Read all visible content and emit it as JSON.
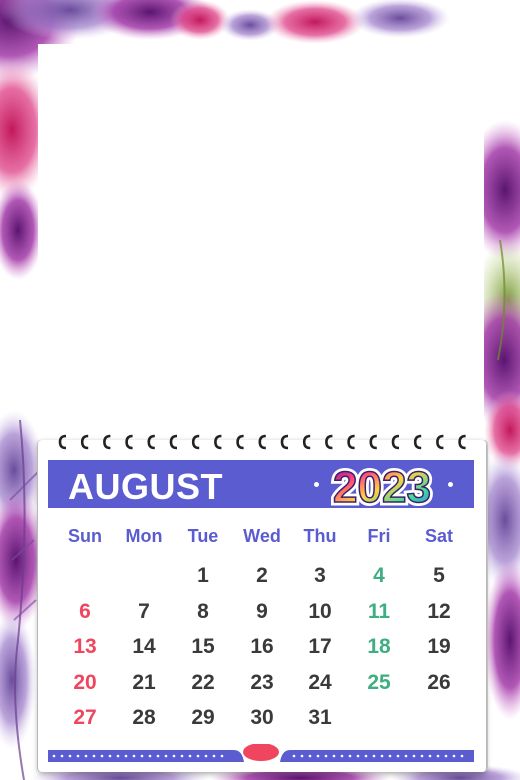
{
  "calendar": {
    "month": "AUGUST",
    "year": "2023",
    "weekdays": [
      "Sun",
      "Mon",
      "Tue",
      "Wed",
      "Thu",
      "Fri",
      "Sat"
    ],
    "weeks": [
      [
        "",
        "",
        "1",
        "2",
        "3",
        "4",
        "5"
      ],
      [
        "6",
        "7",
        "8",
        "9",
        "10",
        "11",
        "12"
      ],
      [
        "13",
        "14",
        "15",
        "16",
        "17",
        "18",
        "19"
      ],
      [
        "20",
        "21",
        "22",
        "23",
        "24",
        "25",
        "26"
      ],
      [
        "27",
        "28",
        "29",
        "30",
        "31",
        "",
        ""
      ]
    ]
  },
  "colors": {
    "header": "#5a5cd0",
    "sunday": "#f0455e",
    "friday": "#3fae82",
    "default_day": "#3a3a3a",
    "floral_primary": "#7a2a8e",
    "floral_accent": "#d0327a"
  }
}
